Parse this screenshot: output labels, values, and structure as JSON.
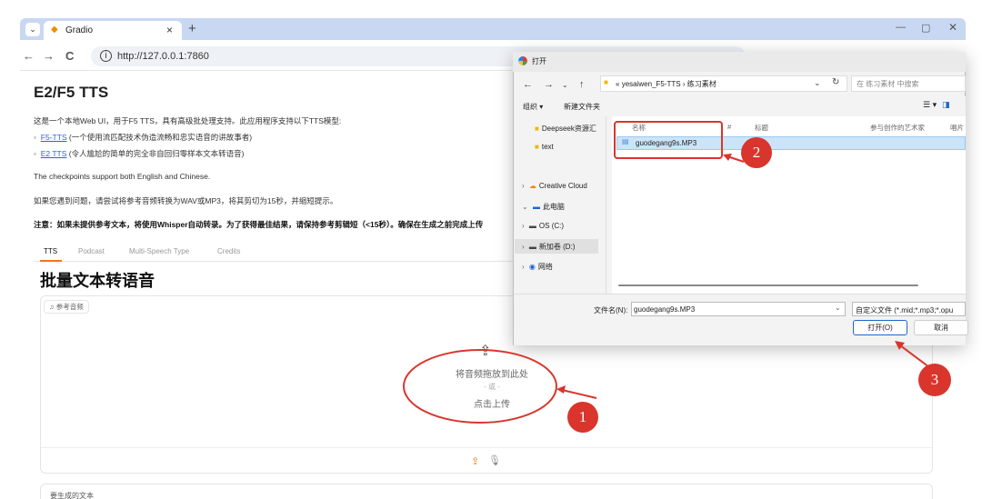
{
  "browser": {
    "tab_title": "Gradio",
    "tab_close": "×",
    "new_tab": "+",
    "url": "http://127.0.0.1:7860",
    "back": "←",
    "forward": "→",
    "reload": "C",
    "info": "i",
    "tab_menu": "⌄",
    "win_min": "—",
    "win_max": "▢",
    "win_close": "✕"
  },
  "page": {
    "title": "E2/F5 TTS",
    "intro": "这是一个本地Web UI，用于F5 TTS，具有高级批处理支持。此应用程序支持以下TTS模型:",
    "bullets": [
      {
        "link": "F5-TTS",
        "text": " (一个使用流匹配技术伪造流畅和忠实语音的讲故事者)"
      },
      {
        "link": "E2 TTS",
        "text": " (令人尴尬的简单的完全非自回归零样本文本转语音)"
      }
    ],
    "checkpoints": "The checkpoints support both English and Chinese.",
    "hint": "如果您遇到问题，请尝试将参考音频转换为WAV或MP3，将其剪切为15秒，并缩短提示。",
    "warning": "注意：如果未提供参考文本，将使用Whisper自动转录。为了获得最佳结果，请保持参考剪辑短（<15秒）。确保在生成之前完成上传",
    "tabs": [
      "TTS",
      "Podcast",
      "Multi-Speech Type",
      "Credits"
    ],
    "section_title": "批量文本转语音",
    "audio_label": "♫ 参考音频",
    "drop_text": "将音频拖放到此处",
    "or_text": "- 或 -",
    "click_upload": "点击上传",
    "text_label": "要生成的文本"
  },
  "dialog": {
    "title": "打开",
    "path": "yesaiwen_F5-TTS  ›  练习素材",
    "path_prefix": "«",
    "search_placeholder": "在 练习素材 中搜索",
    "organize": "组织 ▾",
    "new_folder": "新建文件夹",
    "nav_items": [
      {
        "label": "Deepseek资源汇",
        "icon": "folder-icon"
      },
      {
        "label": "text",
        "icon": "folder-icon"
      },
      {
        "label": "Creative Cloud",
        "icon": "cloud-icon"
      },
      {
        "label": "此电脑",
        "icon": "computer-icon"
      },
      {
        "label": "OS (C:)",
        "icon": "drive-icon"
      },
      {
        "label": "新加卷 (D:)",
        "icon": "drive-icon"
      },
      {
        "label": "网络",
        "icon": "network-icon"
      }
    ],
    "columns": [
      "名称",
      "#",
      "标题",
      "参与创作的艺术家",
      "唱片"
    ],
    "file": "guodegang9s.MP3",
    "filename_label": "文件名(N):",
    "filename_value": "guodegang9s.MP3",
    "filter": "自定义文件 (*.mid;*.mp3;*.opu",
    "open_button": "打开(O)",
    "cancel_button": "取消"
  },
  "annotations": [
    "1",
    "2",
    "3"
  ],
  "colors": {
    "annotation": "#d9352d",
    "accent": "#f97316",
    "link": "#2563eb"
  }
}
